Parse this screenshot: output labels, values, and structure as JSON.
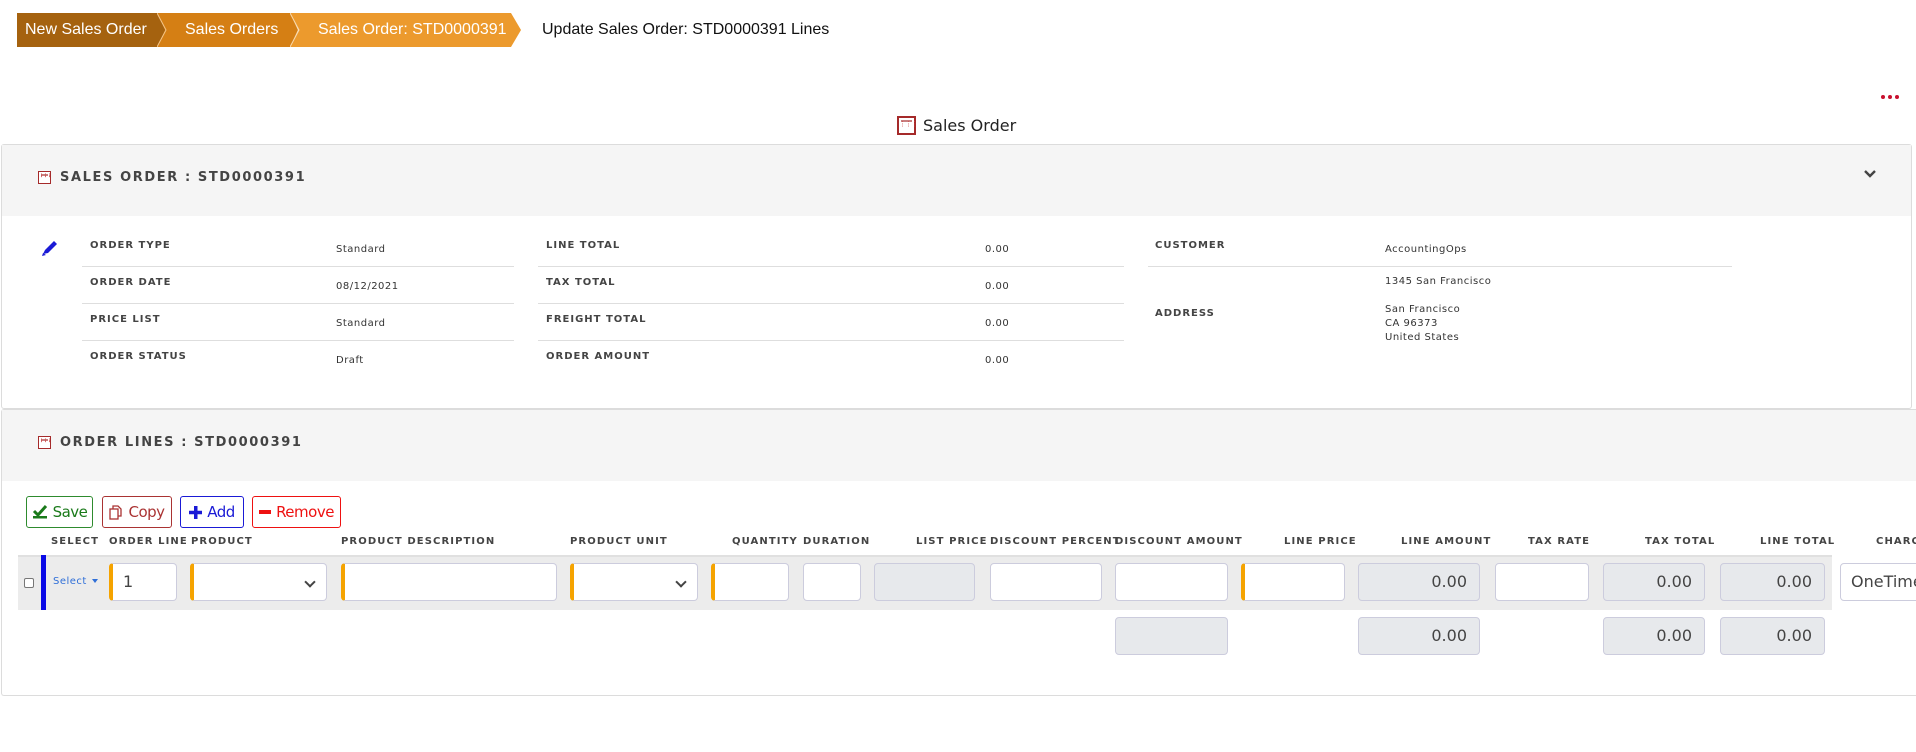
{
  "breadcrumb": {
    "items": [
      {
        "label": "New Sales Order"
      },
      {
        "label": "Sales Orders"
      },
      {
        "label": "Sales Order: STD0000391"
      }
    ],
    "current": "Update Sales Order: STD0000391 Lines"
  },
  "page": {
    "title": "Sales Order",
    "more_menu_icon": "ellipsis-icon"
  },
  "colors": {
    "breadcrumb_1": "#a5620f",
    "breadcrumb_2": "#d57f14",
    "breadcrumb_3": "#ec9a2d",
    "required_marker": "#f5a300",
    "selected_row_marker": "#0a0ae6"
  },
  "sales_order": {
    "title": "SALES ORDER : STD0000391",
    "edit_icon": "pencil-icon",
    "fields_left": [
      {
        "label": "ORDER TYPE",
        "value": "Standard"
      },
      {
        "label": "ORDER DATE",
        "value": "08/12/2021"
      },
      {
        "label": "PRICE LIST",
        "value": "Standard"
      },
      {
        "label": "ORDER STATUS",
        "value": "Draft"
      }
    ],
    "fields_middle": [
      {
        "label": "LINE TOTAL",
        "value": "0.00"
      },
      {
        "label": "TAX TOTAL",
        "value": "0.00"
      },
      {
        "label": "FREIGHT TOTAL",
        "value": "0.00"
      },
      {
        "label": "ORDER AMOUNT",
        "value": "0.00"
      }
    ],
    "customer": {
      "label": "CUSTOMER",
      "value": "AccountingOps"
    },
    "address": {
      "label": "ADDRESS",
      "lines": [
        "1345 San Francisco",
        "San Francisco",
        "CA 96373",
        "United States"
      ]
    }
  },
  "order_lines": {
    "title": "ORDER LINES : STD0000391",
    "toolbar": {
      "save_label": "Save",
      "copy_label": "Copy",
      "add_label": "Add",
      "remove_label": "Remove"
    },
    "columns": [
      "SELECT",
      "ORDER LINE",
      "PRODUCT",
      "PRODUCT DESCRIPTION",
      "PRODUCT UNIT",
      "QUANTITY",
      "DURATION",
      "LIST PRICE",
      "DISCOUNT PERCENT",
      "DISCOUNT AMOUNT",
      "LINE PRICE",
      "LINE AMOUNT",
      "TAX RATE",
      "TAX TOTAL",
      "LINE TOTAL",
      "CHARGE"
    ],
    "rows": [
      {
        "select_label": "Select",
        "checked": false,
        "order_line": "1",
        "product": "",
        "product_description": "",
        "product_unit": "",
        "quantity": "",
        "duration": "",
        "list_price": "",
        "discount_percent": "",
        "discount_amount": "",
        "line_price": "",
        "line_amount": "0.00",
        "tax_rate": "",
        "tax_total": "0.00",
        "line_total": "0.00",
        "charge": "OneTime"
      }
    ],
    "totals": {
      "discount_amount": "",
      "line_amount": "0.00",
      "tax_total": "0.00",
      "line_total": "0.00"
    }
  }
}
